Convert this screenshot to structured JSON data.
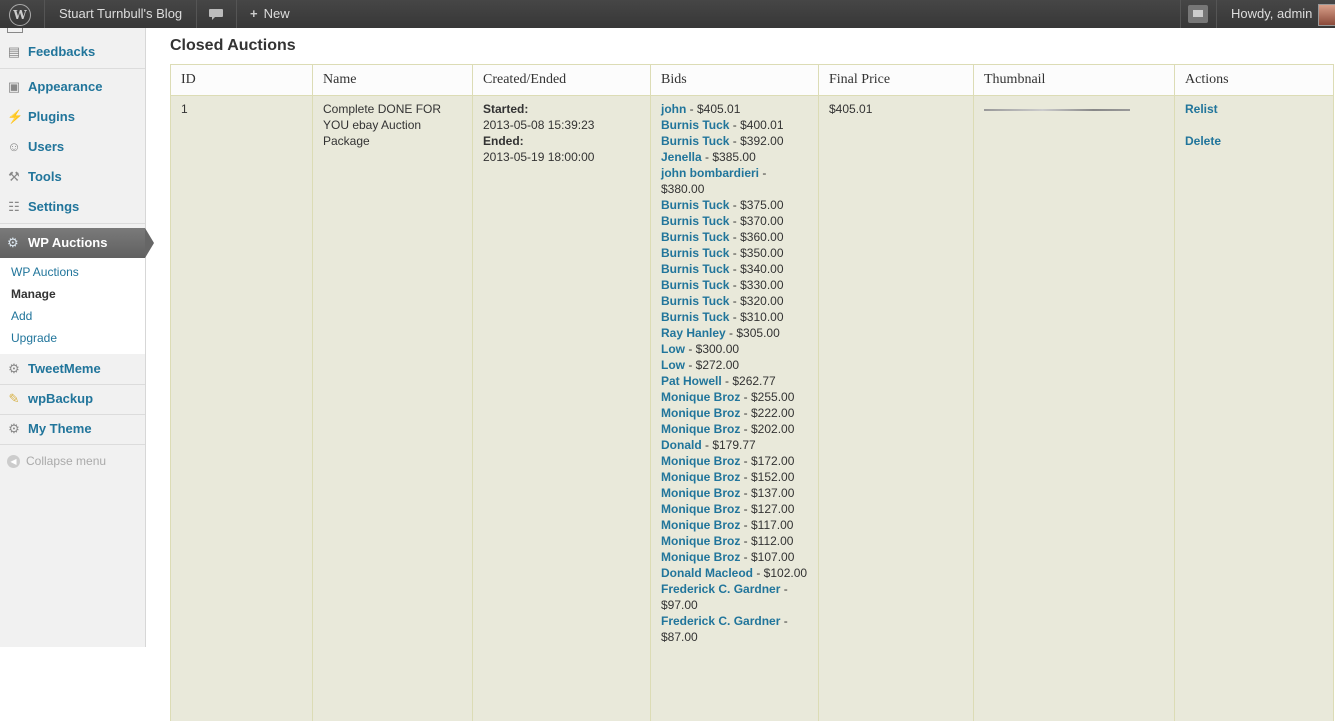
{
  "admin_bar": {
    "site_name": "Stuart Turnbull's Blog",
    "new_label": "New",
    "howdy": "Howdy, admin"
  },
  "sidebar": {
    "items": [
      {
        "label": "Feedbacks",
        "icon": "feedback-icon"
      },
      {
        "label": "Appearance",
        "icon": "appearance-icon"
      },
      {
        "label": "Plugins",
        "icon": "plugins-icon"
      },
      {
        "label": "Users",
        "icon": "users-icon"
      },
      {
        "label": "Tools",
        "icon": "tools-icon"
      },
      {
        "label": "Settings",
        "icon": "settings-icon"
      }
    ],
    "current": {
      "label": "WP Auctions",
      "icon": "gear-icon"
    },
    "submenu": [
      {
        "label": "WP Auctions"
      },
      {
        "label": "Manage"
      },
      {
        "label": "Add"
      },
      {
        "label": "Upgrade"
      }
    ],
    "lower_items": [
      {
        "label": "TweetMeme",
        "icon": "gear-icon"
      },
      {
        "label": "wpBackup",
        "icon": "tag-icon"
      },
      {
        "label": "My Theme",
        "icon": "gear-icon"
      }
    ],
    "collapse_label": "Collapse menu"
  },
  "main": {
    "title": "Closed Auctions",
    "columns": [
      "ID",
      "Name",
      "Created/Ended",
      "Bids",
      "Final Price",
      "Thumbnail",
      "Actions"
    ],
    "row": {
      "id": "1",
      "name": "Complete DONE FOR YOU ebay Auction Package",
      "started_label": "Started:",
      "started": "2013-05-08 15:39:23",
      "ended_label": "Ended:",
      "ended": "2013-05-19 18:00:00",
      "final_price": "$405.01",
      "actions": [
        "Relist",
        "Delete"
      ],
      "bids": [
        {
          "bidder": "john",
          "amount": " - $405.01"
        },
        {
          "bidder": "Burnis Tuck",
          "amount": " - $400.01"
        },
        {
          "bidder": "Burnis Tuck",
          "amount": " - $392.00"
        },
        {
          "bidder": "Jenella",
          "amount": " - $385.00"
        },
        {
          "bidder": "john bombardieri",
          "amount": " - $380.00"
        },
        {
          "bidder": "Burnis Tuck",
          "amount": " - $375.00"
        },
        {
          "bidder": "Burnis Tuck",
          "amount": " - $370.00"
        },
        {
          "bidder": "Burnis Tuck",
          "amount": " - $360.00"
        },
        {
          "bidder": "Burnis Tuck",
          "amount": " - $350.00"
        },
        {
          "bidder": "Burnis Tuck",
          "amount": " - $340.00"
        },
        {
          "bidder": "Burnis Tuck",
          "amount": " - $330.00"
        },
        {
          "bidder": "Burnis Tuck",
          "amount": " - $320.00"
        },
        {
          "bidder": "Burnis Tuck",
          "amount": " - $310.00"
        },
        {
          "bidder": "Ray Hanley",
          "amount": " - $305.00"
        },
        {
          "bidder": "Low",
          "amount": " - $300.00"
        },
        {
          "bidder": "Low",
          "amount": " - $272.00"
        },
        {
          "bidder": "Pat Howell",
          "amount": " - $262.77"
        },
        {
          "bidder": "Monique Broz",
          "amount": " - $255.00"
        },
        {
          "bidder": "Monique Broz",
          "amount": " - $222.00"
        },
        {
          "bidder": "Monique Broz",
          "amount": " - $202.00"
        },
        {
          "bidder": "Donald",
          "amount": " - $179.77"
        },
        {
          "bidder": "Monique Broz",
          "amount": " - $172.00"
        },
        {
          "bidder": "Monique Broz",
          "amount": " - $152.00"
        },
        {
          "bidder": "Monique Broz",
          "amount": " - $137.00"
        },
        {
          "bidder": "Monique Broz",
          "amount": " - $127.00"
        },
        {
          "bidder": "Monique Broz",
          "amount": " - $117.00"
        },
        {
          "bidder": "Monique Broz",
          "amount": " - $112.00"
        },
        {
          "bidder": "Monique Broz",
          "amount": " - $107.00"
        },
        {
          "bidder": "Donald Macleod",
          "amount": " - $102.00"
        },
        {
          "bidder": "Frederick C. Gardner",
          "amount": " - $97.00"
        },
        {
          "bidder": "Frederick C. Gardner",
          "amount": " - $87.00"
        }
      ]
    }
  },
  "colors": {
    "admin_bar": "#464646",
    "link": "#21759b",
    "row_bg": "#e9e9da",
    "sidebar_bg": "#f1f1f1"
  }
}
